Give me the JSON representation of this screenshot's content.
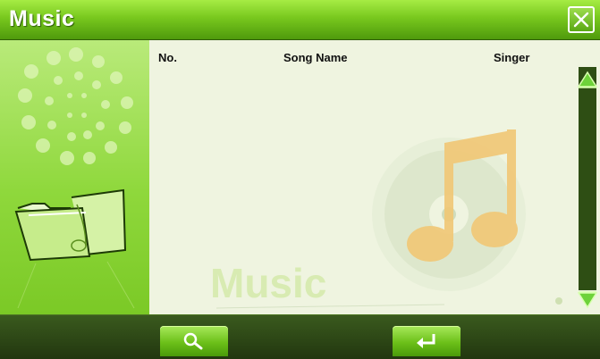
{
  "window": {
    "title": "Music"
  },
  "list": {
    "columns": {
      "no": "No.",
      "song_name": "Song Name",
      "singer": "Singer"
    },
    "rows": [],
    "watermark": "Music"
  },
  "icons": {
    "close": "close-icon",
    "folder": "folder-icon",
    "scroll_up": "scroll-up-arrow-icon",
    "scroll_down": "scroll-down-arrow-icon",
    "search": "search-icon",
    "enter": "enter-icon"
  },
  "colors": {
    "accent": "#78c81e",
    "panel_bg": "#eff4e0",
    "bottom_bar": "#2a4415"
  }
}
